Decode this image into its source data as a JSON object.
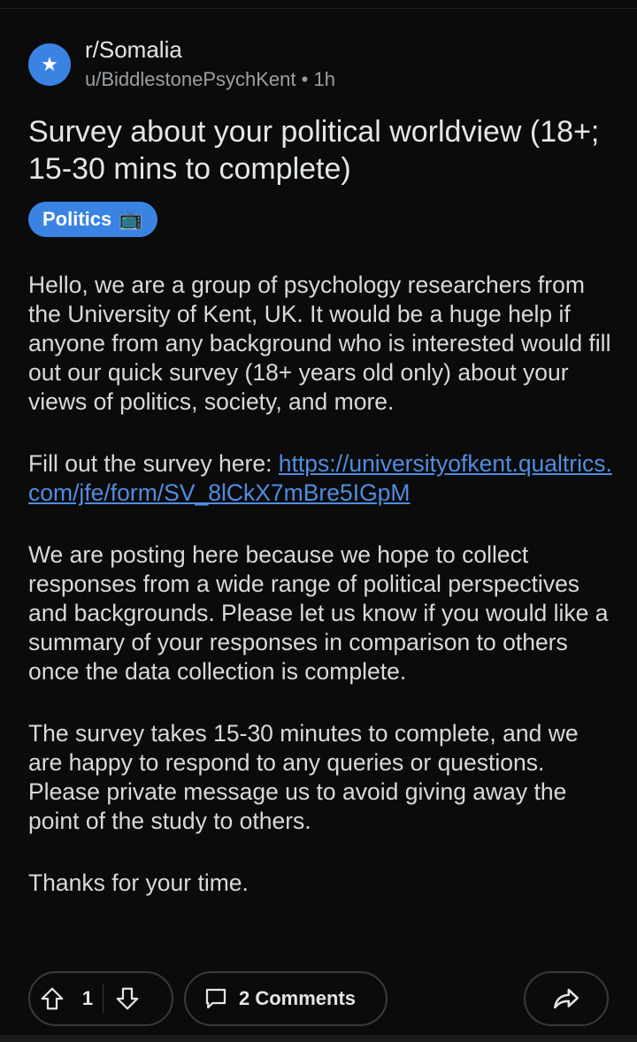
{
  "post": {
    "subreddit": "r/Somalia",
    "author": "u/BiddlestonePsychKent",
    "separator": "•",
    "time": "1h",
    "title": "Survey about your political worldview (18+; 15-30 mins to complete)",
    "flair": {
      "label": "Politics",
      "emoji": "📺"
    },
    "body": {
      "p1": "Hello, we are a group of psychology researchers from the University of Kent, UK. It would be a huge help if anyone from any background who is interested would fill out our quick survey (18+ years old only) about your views of politics, society, and more.",
      "p2_prefix": "Fill out the survey here: ",
      "p2_link": "https://universityofkent.qualtrics.com/jfe/form/SV_8lCkX7mBre5IGpM",
      "p3": "We are posting here because we hope to collect responses from a wide range of political perspectives and backgrounds. Please let us know if you would like a summary of your responses in comparison to others once the data collection is complete.",
      "p4": "The survey takes 15-30 minutes to complete, and we are happy to respond to any queries or questions. Please private message us to avoid giving away the point of the study to others.",
      "p5": "Thanks for your time."
    }
  },
  "actions": {
    "vote_count": "1",
    "comments_label": "2 Comments"
  },
  "colors": {
    "accent": "#3a83e3",
    "link": "#4f8de0",
    "background": "#0b0b0b"
  }
}
